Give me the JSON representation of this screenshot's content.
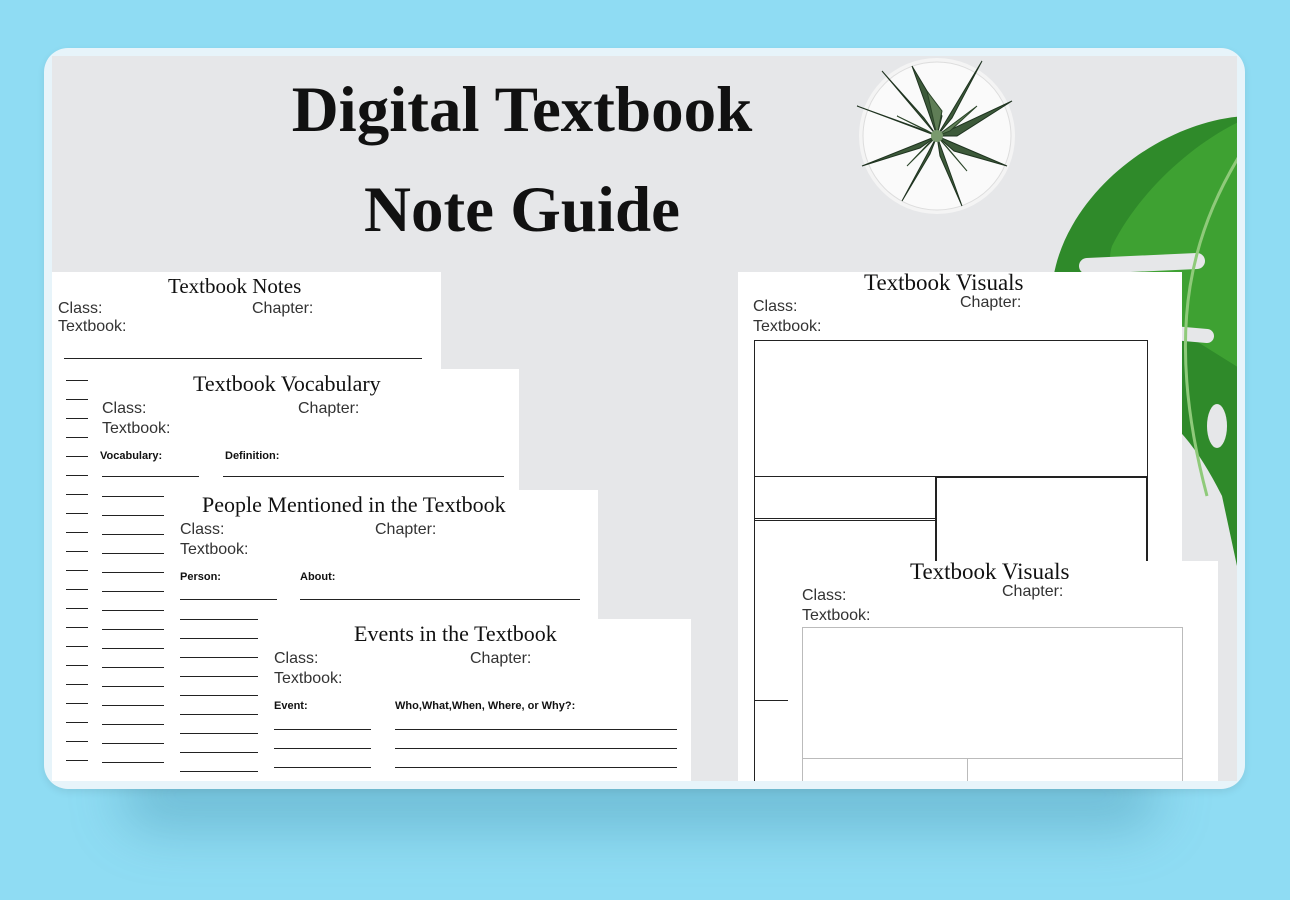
{
  "title": {
    "line1": "Digital Textbook",
    "line2": "Note Guide"
  },
  "sheets": {
    "notes": {
      "title": "Textbook Notes",
      "class_label": "Class:",
      "chapter_label": "Chapter:",
      "textbook_label": "Textbook:"
    },
    "vocabulary": {
      "title": "Textbook Vocabulary",
      "class_label": "Class:",
      "chapter_label": "Chapter:",
      "textbook_label": "Textbook:",
      "col1": "Vocabulary:",
      "col2": "Definition:"
    },
    "people": {
      "title": "People Mentioned in the Textbook",
      "class_label": "Class:",
      "chapter_label": "Chapter:",
      "textbook_label": "Textbook:",
      "col1": "Person:",
      "col2": "About:"
    },
    "events": {
      "title": "Events in the Textbook",
      "class_label": "Class:",
      "chapter_label": "Chapter:",
      "textbook_label": "Textbook:",
      "col1": "Event:",
      "col2": "Who,What,When, Where, or Why?:"
    },
    "visuals_back": {
      "title": "Textbook Visuals",
      "class_label": "Class:",
      "chapter_label": "Chapter:",
      "textbook_label": "Textbook:"
    },
    "visuals_front": {
      "title": "Textbook Visuals",
      "class_label": "Class:",
      "chapter_label": "Chapter:",
      "textbook_label": "Textbook:"
    }
  },
  "colors": {
    "background": "#8fdcf3",
    "canvas": "#e6e7e9",
    "leaf": "#2f8a2a",
    "ink": "#111111"
  }
}
